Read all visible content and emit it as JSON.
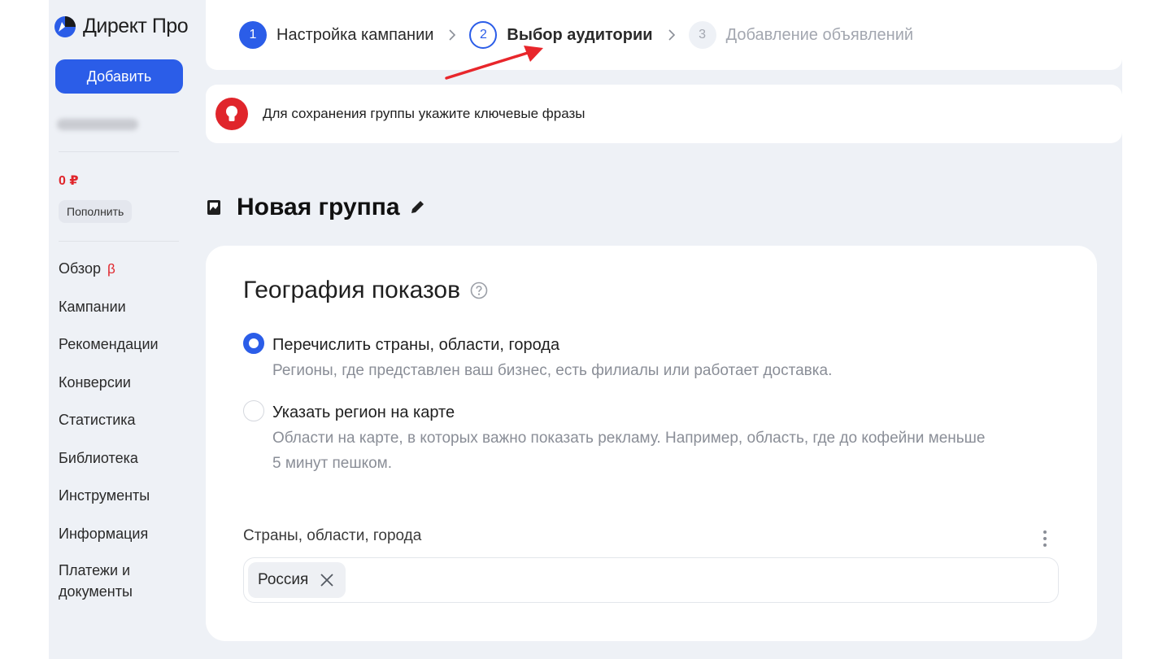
{
  "sidebar": {
    "logo_text": "Директ Про",
    "add_label": "Добавить",
    "balance": "0 ₽",
    "topup_label": "Пополнить",
    "nav": [
      {
        "label": "Обзор",
        "badge": "β"
      },
      {
        "label": "Кампании"
      },
      {
        "label": "Рекомендации"
      },
      {
        "label": "Конверсии"
      },
      {
        "label": "Статистика"
      },
      {
        "label": "Библиотека"
      },
      {
        "label": "Инструменты"
      },
      {
        "label": "Информация"
      },
      {
        "label": "Платежи и",
        "label2": "документы"
      }
    ]
  },
  "stepper": {
    "steps": [
      {
        "num": "1",
        "label": "Настройка кампании",
        "state": "done"
      },
      {
        "num": "2",
        "label": "Выбор аудитории",
        "state": "active"
      },
      {
        "num": "3",
        "label": "Добавление объявлений",
        "state": "upcoming"
      }
    ]
  },
  "alert": {
    "text": "Для сохранения группы укажите ключевые фразы",
    "color": "#e0252b"
  },
  "group": {
    "title": "Новая группа"
  },
  "geo": {
    "title": "География показов",
    "options": [
      {
        "title": "Перечислить страны, области, города",
        "desc": "Регионы, где представлен ваш бизнес, есть филиалы или работает доставка.",
        "selected": true
      },
      {
        "title": "Указать регион на карте",
        "desc": "Области на карте, в которых важно показать рекламу. Например, область, где до кофейни меньше",
        "desc2": "5 минут пешком.",
        "selected": false
      }
    ],
    "field_label": "Страны, области, города",
    "chips": [
      {
        "label": "Россия"
      }
    ]
  },
  "colors": {
    "accent": "#2b5de8",
    "danger": "#e0252b",
    "background": "#eef1f6"
  },
  "icons": [
    "direct-logo-icon",
    "chevron-right-icon",
    "lightbulb-icon",
    "image-icon",
    "pencil-icon",
    "help-icon",
    "more-vertical-icon",
    "close-icon"
  ]
}
